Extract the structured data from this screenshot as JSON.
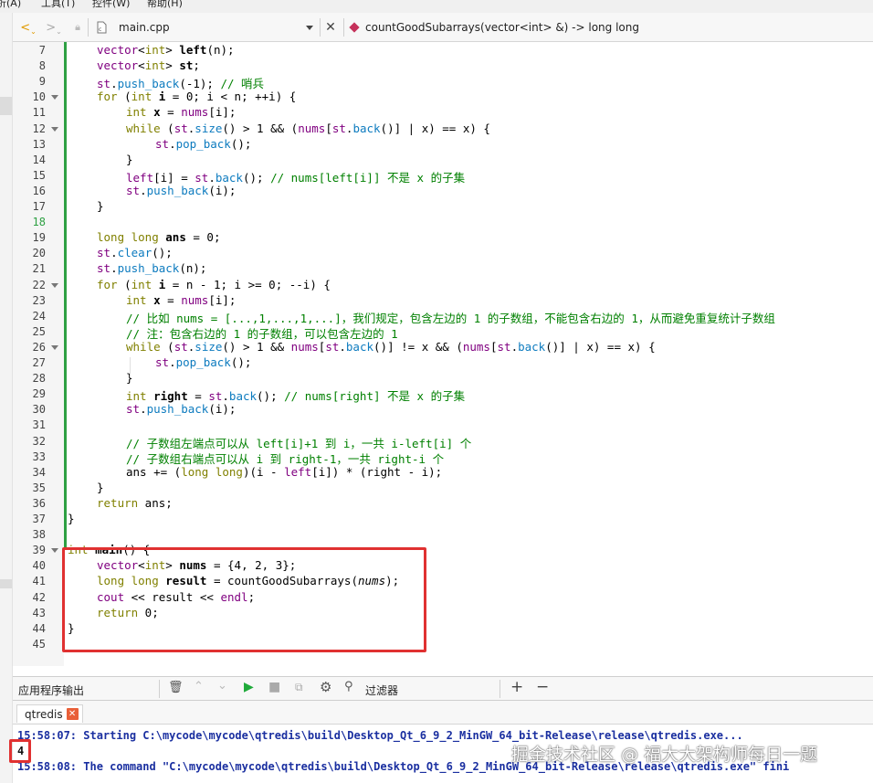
{
  "menubar": {
    "items": [
      "析(A)",
      "工具(T)",
      "控件(W)",
      "帮助(H)"
    ]
  },
  "toolbar": {
    "file_name": "main.cpp",
    "function_signature": "countGoodSubarrays(vector<int> &) -> long long"
  },
  "editor": {
    "current_line": 18
  },
  "output_panel": {
    "title": "应用程序输出",
    "filter_label": "过滤器",
    "tab_name": "qtredis",
    "lines": [
      "15:58:07: Starting C:\\mycode\\mycode\\qtredis\\build\\Desktop_Qt_6_9_2_MinGW_64_bit-Release\\release\\qtredis.exe...",
      "4",
      "15:58:08: The command \"C:\\mycode\\mycode\\qtredis\\build\\Desktop_Qt_6_9_2_MinGW_64_bit-Release\\release\\qtredis.exe\" fini"
    ]
  },
  "watermark": "掘金技术社区 @ 福大大架构师每日一题",
  "code_lines": [
    {
      "n": 7,
      "indent": 1,
      "segs": [
        [
          "vector",
          "t"
        ],
        [
          "<",
          ""
        ],
        [
          "int",
          "k"
        ],
        [
          "> ",
          ""
        ],
        [
          "left",
          "b"
        ],
        [
          "(n);",
          ""
        ]
      ]
    },
    {
      "n": 8,
      "indent": 1,
      "segs": [
        [
          "vector",
          "t"
        ],
        [
          "<",
          ""
        ],
        [
          "int",
          "k"
        ],
        [
          "> ",
          ""
        ],
        [
          "st",
          "b"
        ],
        [
          ";",
          ""
        ]
      ]
    },
    {
      "n": 9,
      "indent": 1,
      "segs": [
        [
          "st",
          "t"
        ],
        [
          ".",
          ""
        ],
        [
          "push_back",
          "p"
        ],
        [
          "(-1); ",
          ""
        ],
        [
          "// 哨兵",
          "c"
        ]
      ]
    },
    {
      "n": 10,
      "indent": 1,
      "fold": true,
      "segs": [
        [
          "for",
          "k"
        ],
        [
          " (",
          ""
        ],
        [
          "int",
          "k"
        ],
        [
          " ",
          ""
        ],
        [
          "i",
          "b"
        ],
        [
          " = 0; i < n; ++i) {",
          ""
        ]
      ]
    },
    {
      "n": 11,
      "indent": 2,
      "segs": [
        [
          "int",
          "k"
        ],
        [
          " ",
          ""
        ],
        [
          "x",
          "b"
        ],
        [
          " = ",
          ""
        ],
        [
          "nums",
          "t"
        ],
        [
          "[i];",
          ""
        ]
      ]
    },
    {
      "n": 12,
      "indent": 2,
      "fold": true,
      "segs": [
        [
          "while",
          "k"
        ],
        [
          " (",
          ""
        ],
        [
          "st",
          "t"
        ],
        [
          ".",
          ""
        ],
        [
          "size",
          "p"
        ],
        [
          "() > 1 && (",
          ""
        ],
        [
          "nums",
          "t"
        ],
        [
          "[",
          ""
        ],
        [
          "st",
          "t"
        ],
        [
          ".",
          ""
        ],
        [
          "back",
          "p"
        ],
        [
          "()] | x) == x) {",
          ""
        ]
      ]
    },
    {
      "n": 13,
      "indent": 3,
      "segs": [
        [
          "st",
          "t"
        ],
        [
          ".",
          ""
        ],
        [
          "pop_back",
          "p"
        ],
        [
          "();",
          ""
        ]
      ]
    },
    {
      "n": 14,
      "indent": 2,
      "segs": [
        [
          "}",
          ""
        ]
      ]
    },
    {
      "n": 15,
      "indent": 2,
      "segs": [
        [
          "left",
          "t"
        ],
        [
          "[i] = ",
          ""
        ],
        [
          "st",
          "t"
        ],
        [
          ".",
          ""
        ],
        [
          "back",
          "p"
        ],
        [
          "(); ",
          ""
        ],
        [
          "// nums[left[i]] 不是 x 的子集",
          "c"
        ]
      ]
    },
    {
      "n": 16,
      "indent": 2,
      "segs": [
        [
          "st",
          "t"
        ],
        [
          ".",
          ""
        ],
        [
          "push_back",
          "p"
        ],
        [
          "(i);",
          ""
        ]
      ]
    },
    {
      "n": 17,
      "indent": 1,
      "segs": [
        [
          "}",
          ""
        ]
      ]
    },
    {
      "n": 18,
      "indent": 0,
      "segs": []
    },
    {
      "n": 19,
      "indent": 1,
      "segs": [
        [
          "long long",
          "k"
        ],
        [
          " ",
          ""
        ],
        [
          "ans",
          "b"
        ],
        [
          " = 0;",
          ""
        ]
      ]
    },
    {
      "n": 20,
      "indent": 1,
      "segs": [
        [
          "st",
          "t"
        ],
        [
          ".",
          ""
        ],
        [
          "clear",
          "p"
        ],
        [
          "();",
          ""
        ]
      ]
    },
    {
      "n": 21,
      "indent": 1,
      "segs": [
        [
          "st",
          "t"
        ],
        [
          ".",
          ""
        ],
        [
          "push_back",
          "p"
        ],
        [
          "(n);",
          ""
        ]
      ]
    },
    {
      "n": 22,
      "indent": 1,
      "fold": true,
      "segs": [
        [
          "for",
          "k"
        ],
        [
          " (",
          ""
        ],
        [
          "int",
          "k"
        ],
        [
          " ",
          ""
        ],
        [
          "i",
          "b"
        ],
        [
          " = n - 1; i >= 0; --i) {",
          ""
        ]
      ]
    },
    {
      "n": 23,
      "indent": 2,
      "segs": [
        [
          "int",
          "k"
        ],
        [
          " ",
          ""
        ],
        [
          "x",
          "b"
        ],
        [
          " = ",
          ""
        ],
        [
          "nums",
          "t"
        ],
        [
          "[i];",
          ""
        ]
      ]
    },
    {
      "n": 24,
      "indent": 2,
      "segs": [
        [
          "// 比如 nums = [...,1,...,1,...]，我们规定，包含左边的 1 的子数组，不能包含右边的 1，从而避免重复统计子数组",
          "c"
        ]
      ]
    },
    {
      "n": 25,
      "indent": 2,
      "segs": [
        [
          "// 注：包含右边的 1 的子数组，可以包含左边的 1",
          "c"
        ]
      ]
    },
    {
      "n": 26,
      "indent": 2,
      "fold": true,
      "segs": [
        [
          "while",
          "k"
        ],
        [
          " (",
          ""
        ],
        [
          "st",
          "t"
        ],
        [
          ".",
          ""
        ],
        [
          "size",
          "p"
        ],
        [
          "() > 1 && ",
          ""
        ],
        [
          "nums",
          "t"
        ],
        [
          "[",
          ""
        ],
        [
          "st",
          "t"
        ],
        [
          ".",
          ""
        ],
        [
          "back",
          "p"
        ],
        [
          "()] != x && (",
          ""
        ],
        [
          "nums",
          "t"
        ],
        [
          "[",
          ""
        ],
        [
          "st",
          "t"
        ],
        [
          ".",
          ""
        ],
        [
          "back",
          "p"
        ],
        [
          "()] | x) == x) {",
          ""
        ]
      ]
    },
    {
      "n": 27,
      "indent": 3,
      "segs": [
        [
          "st",
          "t"
        ],
        [
          ".",
          ""
        ],
        [
          "pop_back",
          "p"
        ],
        [
          "();",
          ""
        ]
      ]
    },
    {
      "n": 28,
      "indent": 2,
      "segs": [
        [
          "}",
          ""
        ]
      ]
    },
    {
      "n": 29,
      "indent": 2,
      "segs": [
        [
          "int",
          "k"
        ],
        [
          " ",
          ""
        ],
        [
          "right",
          "b"
        ],
        [
          " = ",
          ""
        ],
        [
          "st",
          "t"
        ],
        [
          ".",
          ""
        ],
        [
          "back",
          "p"
        ],
        [
          "(); ",
          ""
        ],
        [
          "// nums[right] 不是 x 的子集",
          "c"
        ]
      ]
    },
    {
      "n": 30,
      "indent": 2,
      "segs": [
        [
          "st",
          "t"
        ],
        [
          ".",
          ""
        ],
        [
          "push_back",
          "p"
        ],
        [
          "(i);",
          ""
        ]
      ]
    },
    {
      "n": 31,
      "indent": 0,
      "segs": []
    },
    {
      "n": 32,
      "indent": 2,
      "segs": [
        [
          "// 子数组左端点可以从 left[i]+1 到 i，一共 i-left[i] 个",
          "c"
        ]
      ]
    },
    {
      "n": 33,
      "indent": 2,
      "segs": [
        [
          "// 子数组右端点可以从 i 到 right-1，一共 right-i 个",
          "c"
        ]
      ]
    },
    {
      "n": 34,
      "indent": 2,
      "segs": [
        [
          "ans += (",
          ""
        ],
        [
          "long long",
          "k"
        ],
        [
          ")(i - ",
          ""
        ],
        [
          "left",
          "t"
        ],
        [
          "[i]) * (right - i);",
          ""
        ]
      ]
    },
    {
      "n": 35,
      "indent": 1,
      "segs": [
        [
          "}",
          ""
        ]
      ]
    },
    {
      "n": 36,
      "indent": 1,
      "segs": [
        [
          "return",
          "k"
        ],
        [
          " ans;",
          ""
        ]
      ]
    },
    {
      "n": 37,
      "indent": 0,
      "segs": [
        [
          "}",
          ""
        ]
      ]
    },
    {
      "n": 38,
      "indent": 0,
      "segs": []
    },
    {
      "n": 39,
      "indent": 0,
      "fold": true,
      "segs": [
        [
          "int",
          "k"
        ],
        [
          " ",
          ""
        ],
        [
          "main",
          "b"
        ],
        [
          "() {",
          ""
        ]
      ]
    },
    {
      "n": 40,
      "indent": 1,
      "segs": [
        [
          "vector",
          "t"
        ],
        [
          "<",
          ""
        ],
        [
          "int",
          "k"
        ],
        [
          "> ",
          ""
        ],
        [
          "nums",
          "b"
        ],
        [
          " = {4, 2, 3};",
          ""
        ]
      ]
    },
    {
      "n": 41,
      "indent": 1,
      "segs": [
        [
          "long long",
          "k"
        ],
        [
          " ",
          ""
        ],
        [
          "result",
          "b"
        ],
        [
          " = countGoodSubarrays(",
          ""
        ],
        [
          "nums",
          "it"
        ],
        [
          ");",
          ""
        ]
      ]
    },
    {
      "n": 42,
      "indent": 1,
      "segs": [
        [
          "cout",
          "t"
        ],
        [
          " << result << ",
          ""
        ],
        [
          "endl",
          "t"
        ],
        [
          ";",
          ""
        ]
      ]
    },
    {
      "n": 43,
      "indent": 1,
      "segs": [
        [
          "return",
          "k"
        ],
        [
          " 0;",
          ""
        ]
      ]
    },
    {
      "n": 44,
      "indent": 0,
      "segs": [
        [
          "}",
          ""
        ]
      ]
    },
    {
      "n": 45,
      "indent": 0,
      "segs": []
    }
  ]
}
